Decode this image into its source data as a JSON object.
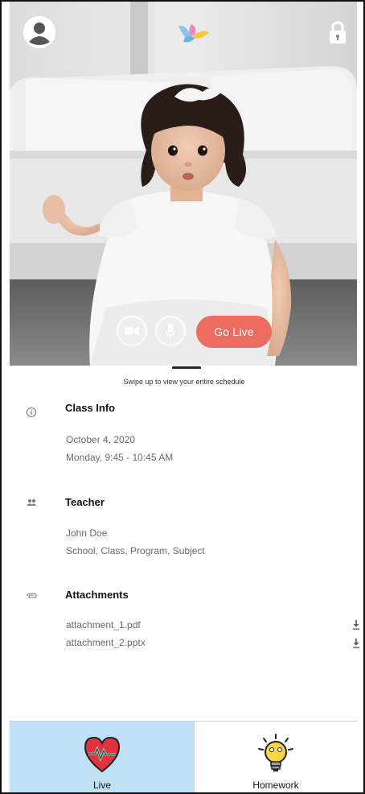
{
  "video": {
    "go_live_label": "Go Live"
  },
  "sheet": {
    "swipe_hint": "Swipe up to view your entire schedule",
    "class_info": {
      "title": "Class Info",
      "date": "October 4, 2020",
      "time": "Monday, 9:45 - 10:45 AM"
    },
    "teacher": {
      "title": "Teacher",
      "name": "John Doe",
      "details": "School, Class, Program, Subject"
    },
    "attachments": {
      "title": "Attachments",
      "items": [
        "attachment_1.pdf",
        "attachment_2.pptx"
      ]
    }
  },
  "nav": {
    "tabs": [
      {
        "label": "Live",
        "icon": "heart-icon",
        "active": true
      },
      {
        "label": "Homework",
        "icon": "lightbulb-icon",
        "active": false
      }
    ]
  },
  "colors": {
    "go_live": "#ec6d5f",
    "active_tab": "#bfe0f5"
  }
}
